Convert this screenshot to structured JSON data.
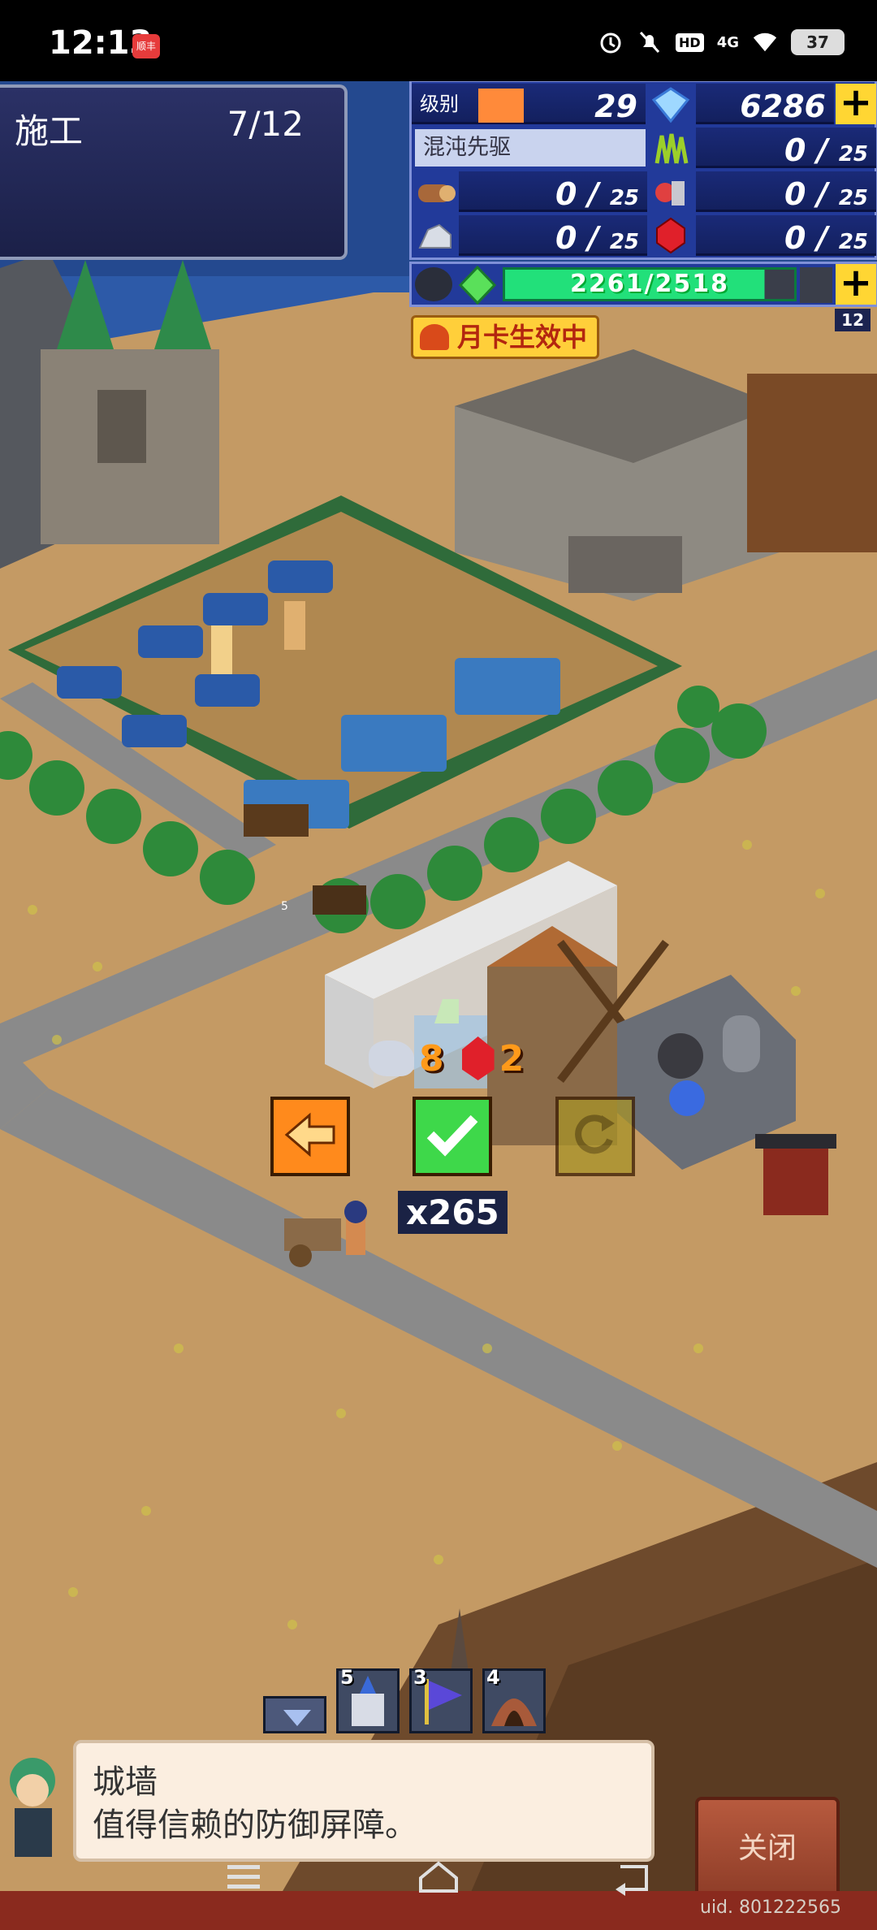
{
  "status_bar": {
    "time": "12:13",
    "app_badge": "顺丰",
    "network": "4G",
    "hd": "HD",
    "battery": "37"
  },
  "build_panel": {
    "title": "施工",
    "count": "7/12"
  },
  "resources": {
    "rank_label": "级别",
    "rank_value": "29",
    "diamonds": "6286",
    "player_title": "混沌先驱",
    "grass": "0",
    "grass_max": "25",
    "wood": "0",
    "wood_max": "25",
    "food": "0",
    "food_max": "25",
    "stone": "0",
    "stone_max": "25",
    "ruby": "0",
    "ruby_max": "25",
    "gem_progress": "2261/2518",
    "gem_fraction": 0.898,
    "corner_value": "12"
  },
  "monthly_card": "月卡生效中",
  "placement": {
    "cost_stone": "8",
    "cost_ruby": "2",
    "multiplier": "x265",
    "small_label": "5"
  },
  "quickbar": [
    {
      "name": "castle-icon",
      "count": "5"
    },
    {
      "name": "flag-icon",
      "count": "3"
    },
    {
      "name": "cave-icon",
      "count": "4"
    }
  ],
  "dialog": {
    "name": "城墙",
    "description": "值得信赖的防御屏障。",
    "close": "关闭"
  },
  "uid": "uid. 801222565",
  "colors": {
    "sand": "#c49a64",
    "road": "#8a8a8a",
    "hud_blue": "#223a9a",
    "ok_green": "#3ed84a",
    "back_orange": "#ff8a1c"
  }
}
